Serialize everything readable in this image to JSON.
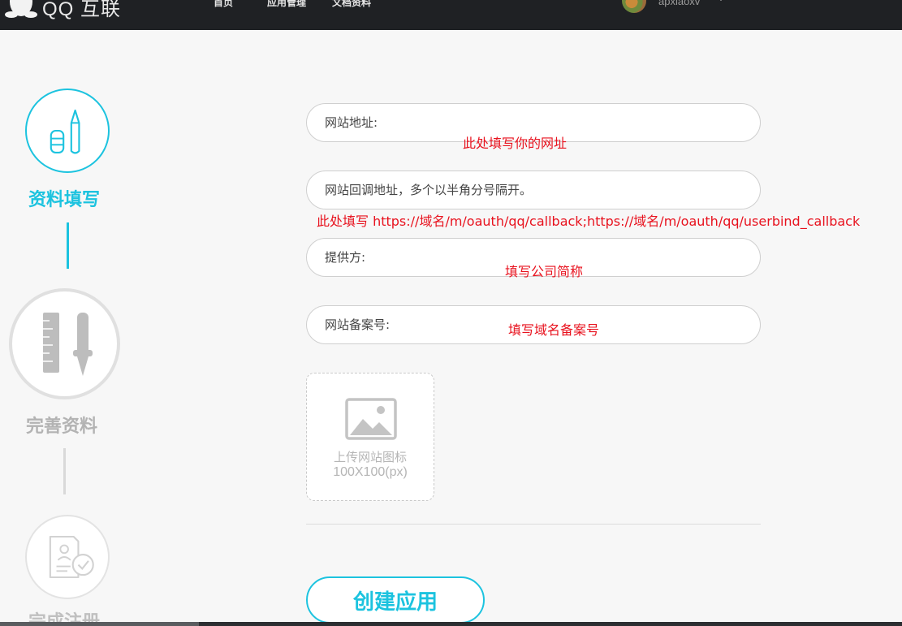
{
  "header": {
    "brand": "QQ 互联",
    "nav": {
      "home": "首页",
      "app_management": "应用管理",
      "docs": "文档资料"
    },
    "username": "apxiaoxv",
    "logo_icon": "penguin-icon",
    "user_menu_icon": "caret-down-icon"
  },
  "steps": [
    {
      "label": "资料填写",
      "icon": "pen-eraser-icon",
      "state": "active"
    },
    {
      "label": "完善资料",
      "icon": "ruler-pen-icon",
      "state": "pending"
    },
    {
      "label": "完成注册",
      "icon": "document-check-icon",
      "state": "pending"
    }
  ],
  "form": {
    "website_url": {
      "placeholder": "网站地址:",
      "value": ""
    },
    "callback_url": {
      "placeholder": "网站回调地址，多个以半角分号隔开。",
      "value": ""
    },
    "provider": {
      "placeholder": "提供方:",
      "value": ""
    },
    "icp_number": {
      "placeholder": "网站备案号:",
      "value": ""
    },
    "upload": {
      "label": "上传网站图标",
      "size_hint": "100X100(px)",
      "icon": "image-placeholder-icon"
    },
    "submit_label": "创建应用"
  },
  "annotations": {
    "website_url": "此处填写你的网址",
    "callback_url": "此处填写 https://域名/m/oauth/qq/callback;https://域名/m/oauth/qq/userbind_callback",
    "provider": "填写公司简称",
    "icp_number": "填写域名备案号"
  },
  "colors": {
    "accent": "#1cc3df",
    "annotation": "#e8121e",
    "topbar": "#1f2124"
  }
}
